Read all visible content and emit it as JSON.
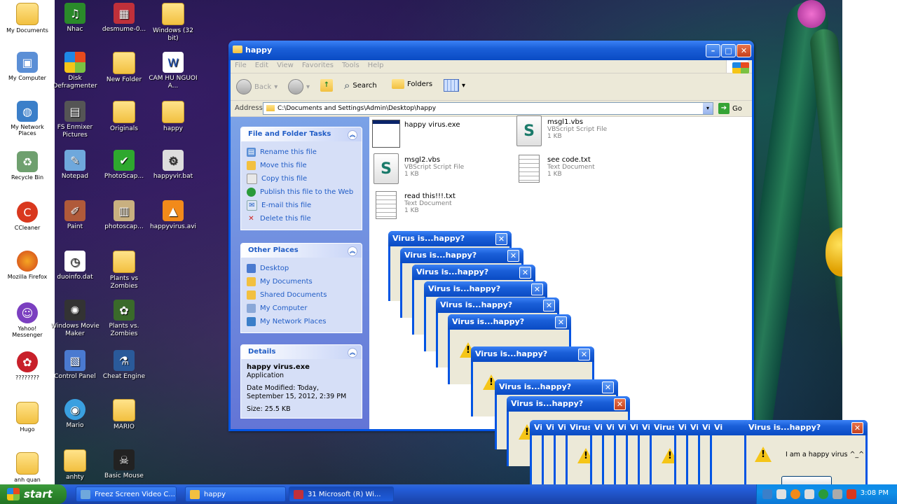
{
  "left_icons": [
    {
      "label": "My Documents",
      "icon": "folder-icon"
    },
    {
      "label": "My Computer",
      "icon": "computer-icon"
    },
    {
      "label": "My Network Places",
      "icon": "network-icon"
    },
    {
      "label": "Recycle Bin",
      "icon": "recycle-bin-icon"
    },
    {
      "label": "CCleaner",
      "icon": "ccleaner-icon"
    },
    {
      "label": "Mozilla Firefox",
      "icon": "firefox-icon"
    },
    {
      "label": "Yahoo! Messenger",
      "icon": "messenger-icon"
    },
    {
      "label": "????????",
      "icon": "app-icon"
    },
    {
      "label": "Hugo",
      "icon": "folder-icon"
    },
    {
      "label": "anh quan",
      "icon": "folder-icon"
    }
  ],
  "desktop_icons": [
    {
      "label": "Nhac",
      "icon": "music-icon"
    },
    {
      "label": "desmume-0...",
      "icon": "app-icon"
    },
    {
      "label": "Windows (32 bit)",
      "icon": "folder-icon"
    },
    {
      "label": "Disk Defragmenter",
      "icon": "defrag-icon"
    },
    {
      "label": "New Folder",
      "icon": "folder-icon"
    },
    {
      "label": "CAM HU NGUOI A...",
      "icon": "document-icon"
    },
    {
      "label": "FS Enmixer Pictures",
      "icon": "picture-icon"
    },
    {
      "label": "Originals",
      "icon": "folder-icon"
    },
    {
      "label": "happy",
      "icon": "folder-icon"
    },
    {
      "label": "Notepad",
      "icon": "notepad-icon"
    },
    {
      "label": "PhotoScap...",
      "icon": "photoscape-icon"
    },
    {
      "label": "happyvir.bat",
      "icon": "batch-icon"
    },
    {
      "label": "Paint",
      "icon": "paint-icon"
    },
    {
      "label": "photoscap...",
      "icon": "archive-icon"
    },
    {
      "label": "happyvirus.avi",
      "icon": "vlc-icon"
    },
    {
      "label": "duoinfo.dat",
      "icon": "file-icon"
    },
    {
      "label": "Plants vs Zombies",
      "icon": "folder-icon"
    },
    {
      "label": "Windows Movie Maker",
      "icon": "movie-maker-icon"
    },
    {
      "label": "Plants vs. Zombies",
      "icon": "game-icon"
    },
    {
      "label": "Control Panel",
      "icon": "control-panel-icon"
    },
    {
      "label": "Cheat Engine",
      "icon": "cheat-engine-icon"
    },
    {
      "label": "Mario",
      "icon": "mario-icon"
    },
    {
      "label": "MARIO",
      "icon": "folder-icon"
    },
    {
      "label": "anhty",
      "icon": "folder-icon"
    },
    {
      "label": "Basic Mouse",
      "icon": "mouse-icon"
    }
  ],
  "window": {
    "title": "happy",
    "menu": [
      "File",
      "Edit",
      "View",
      "Favorites",
      "Tools",
      "Help"
    ],
    "toolbar": {
      "back": "Back",
      "search": "Search",
      "folders": "Folders"
    },
    "address_label": "Address",
    "address_value": "C:\\Documents and Settings\\Admin\\Desktop\\happy",
    "go_label": "Go"
  },
  "file_tasks": {
    "title": "File and Folder Tasks",
    "items": [
      {
        "label": "Rename this file",
        "icon": "rename-icon"
      },
      {
        "label": "Move this file",
        "icon": "move-icon"
      },
      {
        "label": "Copy this file",
        "icon": "copy-icon"
      },
      {
        "label": "Publish this file to the Web",
        "icon": "web-icon"
      },
      {
        "label": "E-mail this file",
        "icon": "email-icon"
      },
      {
        "label": "Delete this file",
        "icon": "delete-icon"
      }
    ]
  },
  "other_places": {
    "title": "Other Places",
    "items": [
      {
        "label": "Desktop",
        "icon": "desktop-icon"
      },
      {
        "label": "My Documents",
        "icon": "folder-icon"
      },
      {
        "label": "Shared Documents",
        "icon": "folder-icon"
      },
      {
        "label": "My Computer",
        "icon": "computer-icon"
      },
      {
        "label": "My Network Places",
        "icon": "network-icon"
      }
    ]
  },
  "details": {
    "title": "Details",
    "name": "happy virus.exe",
    "type": "Application",
    "modified": "Date Modified: Today, September 15, 2012, 2:39 PM",
    "size": "Size: 25.5 KB"
  },
  "files": [
    {
      "name": "happy virus.exe",
      "type": "",
      "size": "",
      "icon": "exe-icon"
    },
    {
      "name": "msgl1.vbs",
      "type": "VBScript Script File",
      "size": "1 KB",
      "icon": "vbs-icon"
    },
    {
      "name": "msgl2.vbs",
      "type": "VBScript Script File",
      "size": "1 KB",
      "icon": "vbs-icon"
    },
    {
      "name": "see code.txt",
      "type": "Text Document",
      "size": "1 KB",
      "icon": "text-icon"
    },
    {
      "name": "read this!!!.txt",
      "type": "Text Document",
      "size": "1 KB",
      "icon": "text-icon"
    }
  ],
  "dialog": {
    "title": "Virus is...happy?",
    "short_title": "Vi",
    "mid_title": "Virus",
    "message": "I am a happy virus ^_^"
  },
  "taskbar": {
    "start_label": "start",
    "buttons": [
      {
        "label": "Freez Screen Video C..."
      },
      {
        "label": "happy"
      },
      {
        "label": "31 Microsoft (R) Wi..."
      }
    ],
    "clock": "3:08 PM"
  }
}
